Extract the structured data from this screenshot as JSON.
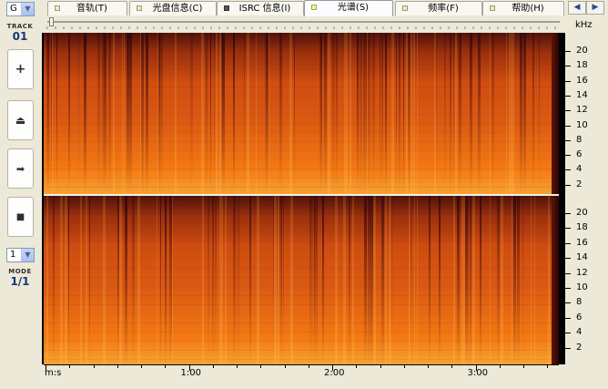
{
  "sidebar": {
    "drive_select": "G",
    "track_label": "TRACK",
    "track_number": "01",
    "mode_select": "1",
    "mode_label": "MODE",
    "mode_value": "1/1",
    "buttons": [
      {
        "icon": "plus-icon",
        "glyph": "+"
      },
      {
        "icon": "eject-icon",
        "glyph": "⏏"
      },
      {
        "icon": "arrow-right-icon",
        "glyph": "➡"
      },
      {
        "icon": "stop-icon",
        "glyph": "■"
      }
    ]
  },
  "tabs": [
    {
      "label": "音轨(T)",
      "mark": "light"
    },
    {
      "label": "光盘信息(C)",
      "mark": "light"
    },
    {
      "label": "ISRC 信息(I)",
      "mark": "dark"
    },
    {
      "label": "光谱(S)",
      "mark": "light",
      "active": true
    },
    {
      "label": "频率(F)",
      "mark": "light"
    },
    {
      "label": "帮助(H)",
      "mark": "light"
    }
  ],
  "tab_scroll": {
    "left": "◀",
    "right": "▶"
  },
  "frequency_axis": {
    "unit": "kHz",
    "labels": [
      "20",
      "18",
      "16",
      "14",
      "12",
      "10",
      "8",
      "6",
      "4",
      "2"
    ]
  },
  "time_axis": {
    "unit_label": "m:s",
    "labels": [
      "1:00",
      "2:00",
      "3:00"
    ]
  },
  "colors": {
    "spectrum_hot": "#f47a14",
    "spectrum_mid": "#c6400c",
    "spectrum_dark": "#2c040c",
    "accent": "#16367a"
  }
}
